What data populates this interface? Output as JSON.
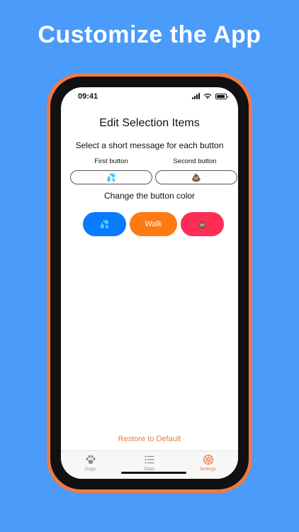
{
  "headline": "Customize the App",
  "status_bar": {
    "time": "09:41"
  },
  "screen": {
    "title": "Edit Selection Items",
    "message_prompt": "Select a short message for each button",
    "first_button_label": "First button",
    "second_button_label": "Second button",
    "first_button_value": "💦",
    "second_button_value": "💩",
    "color_prompt": "Change the button color",
    "color_buttons": [
      {
        "label": "💦",
        "color": "#0a7aff"
      },
      {
        "label": "Walk",
        "color": "#ff7a12"
      },
      {
        "label": "💩",
        "color": "#fe2d55"
      }
    ],
    "restore_label": "Restore to Default"
  },
  "tab_bar": {
    "tabs": [
      {
        "label": "Dogs",
        "icon": "paw-icon",
        "active": false
      },
      {
        "label": "Stats",
        "icon": "list-icon",
        "active": false
      },
      {
        "label": "Settings",
        "icon": "gear-icon",
        "active": true
      }
    ],
    "active_color": "#ef7a45",
    "inactive_color": "#8e8e93"
  },
  "colors": {
    "background": "#4a9bfa",
    "phone_frame": "#ef7a45",
    "accent": "#ef7a45"
  }
}
